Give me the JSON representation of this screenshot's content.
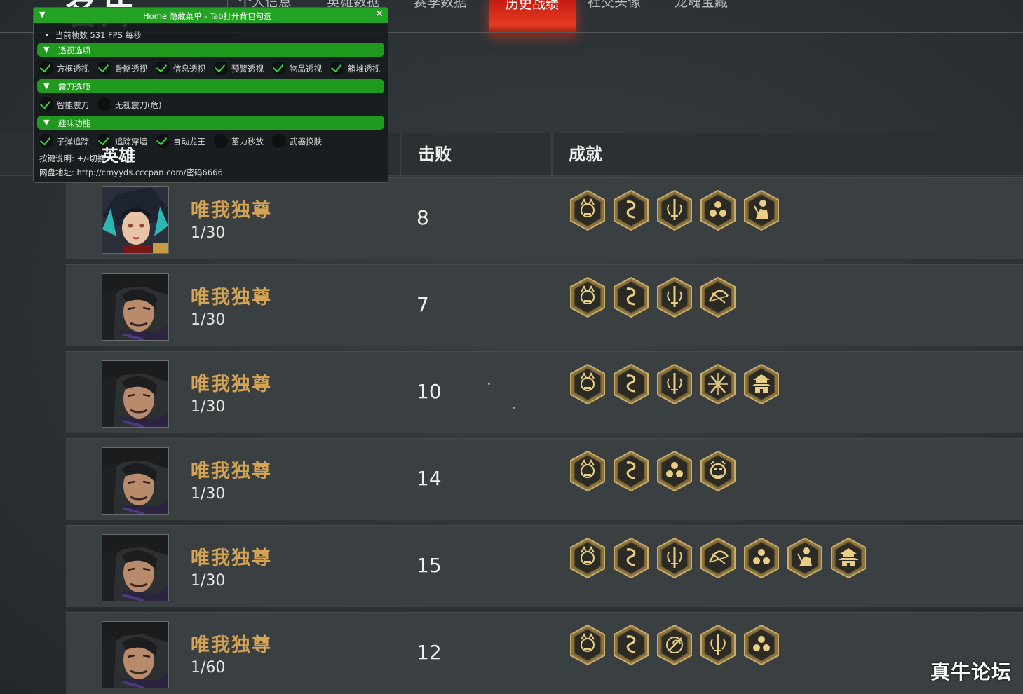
{
  "page_title": "名片",
  "tabs": [
    {
      "label": "个人信息"
    },
    {
      "label": "英雄数据"
    },
    {
      "label": "赛季数据"
    },
    {
      "label": "历史战绩",
      "active": true
    },
    {
      "label": "社交头像"
    },
    {
      "label": "龙魂宝藏"
    }
  ],
  "table": {
    "headers": {
      "hero": "英雄",
      "kills": "击败",
      "achievements": "成就"
    },
    "rows": [
      {
        "avatar": "female-hero-avatar",
        "name": "唯我独尊",
        "mode": "1/30",
        "kills": "8",
        "badges": [
          "demon-mask-icon",
          "serpent-icon",
          "sword-icon",
          "triple-skull-icon",
          "warrior-icon"
        ]
      },
      {
        "avatar": "male-hero-avatar",
        "name": "唯我独尊",
        "mode": "1/30",
        "kills": "7",
        "badges": [
          "demon-mask-icon",
          "serpent-icon",
          "sword-icon",
          "bow-icon"
        ]
      },
      {
        "avatar": "male-hero-avatar",
        "name": "唯我独尊",
        "mode": "1/30",
        "kills": "10",
        "badges": [
          "demon-mask-icon",
          "serpent-icon",
          "sword-icon",
          "crossed-blades-icon",
          "pagoda-icon"
        ]
      },
      {
        "avatar": "male-hero-avatar",
        "name": "唯我独尊",
        "mode": "1/30",
        "kills": "14",
        "badges": [
          "demon-mask-icon",
          "serpent-icon",
          "triple-skull-icon",
          "beast-icon"
        ]
      },
      {
        "avatar": "male-hero-avatar",
        "name": "唯我独尊",
        "mode": "1/30",
        "kills": "15",
        "badges": [
          "demon-mask-icon",
          "serpent-icon",
          "sword-icon",
          "bow-icon",
          "triple-skull-icon",
          "warrior-icon",
          "pagoda-icon"
        ]
      },
      {
        "avatar": "male-hero-avatar",
        "name": "唯我独尊",
        "mode": "1/60",
        "kills": "12",
        "badges": [
          "demon-mask-icon",
          "serpent-icon",
          "spiral-blade-icon",
          "sword-icon",
          "triple-skull-icon"
        ]
      }
    ]
  },
  "overlay_menu": {
    "title": "Home 隐藏菜单 - Tab打开背包勾选",
    "close": "✕",
    "fps": "当前帧数 531 FPS 每秒",
    "sections": [
      {
        "title": "透视选项",
        "options": [
          {
            "label": "方框透视",
            "checked": true
          },
          {
            "label": "骨骼透视",
            "checked": true
          },
          {
            "label": "信息透视",
            "checked": true
          },
          {
            "label": "预警透视",
            "checked": true
          },
          {
            "label": "物品透视",
            "checked": true
          },
          {
            "label": "箱堆透视",
            "checked": true
          }
        ]
      },
      {
        "title": "震刀选项",
        "options": [
          {
            "label": "智能震刀",
            "checked": true
          },
          {
            "label": "无视震刀(危)",
            "checked": false
          }
        ]
      },
      {
        "title": "趣味功能",
        "options": [
          {
            "label": "子弹追踪",
            "checked": true
          },
          {
            "label": "追踪穿墙",
            "checked": true
          },
          {
            "label": "自动龙王",
            "checked": true
          },
          {
            "label": "蓄力秒放",
            "checked": false
          },
          {
            "label": "武器换肤",
            "checked": false
          }
        ]
      }
    ],
    "key_note": "按键说明: +/-切换",
    "download_note": "网盘地址: http://cmyyds.cccpan.com/密码6666"
  },
  "watermark": "真牛论坛",
  "colors": {
    "accent_gold": "#d4a454",
    "active_tab_red": "#d42a1a",
    "menu_green": "#23a223",
    "check_green": "#3ed43e"
  }
}
